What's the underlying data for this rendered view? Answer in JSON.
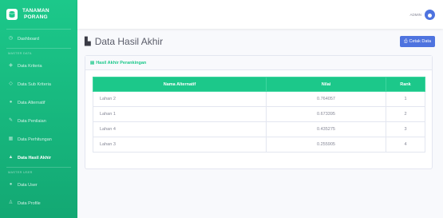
{
  "brand": {
    "line1": "TANAMAN",
    "line2": "PORANG"
  },
  "sidebar": {
    "dashboard": "Dashboard",
    "section_master": "MASTER DATA",
    "items": [
      "Data Kriteria",
      "Data Sub Kriteria",
      "Data Alternatif",
      "Data Penilaian",
      "Data Perhitungan",
      "Data Hasil Akhir"
    ],
    "section_user": "MASTER USER",
    "user_items": [
      "Data User",
      "Data Profile"
    ]
  },
  "topbar": {
    "user": "ADMIN"
  },
  "page": {
    "title": "Data Hasil Akhir",
    "print_label": "Cetak Data"
  },
  "card": {
    "title": "Hasil Akhir Perankingan"
  },
  "table": {
    "headers": [
      "Nama Alternatif",
      "Nilai",
      "Rank"
    ],
    "rows": [
      [
        "Lahan 2",
        "0.764057",
        "1"
      ],
      [
        "Lahan 1",
        "0.673395",
        "2"
      ],
      [
        "Lahan 4",
        "0.435275",
        "3"
      ],
      [
        "Lahan 3",
        "0.255905",
        "4"
      ]
    ]
  },
  "colors": {
    "primary": "#1cc88a",
    "accent": "#4e73df"
  }
}
